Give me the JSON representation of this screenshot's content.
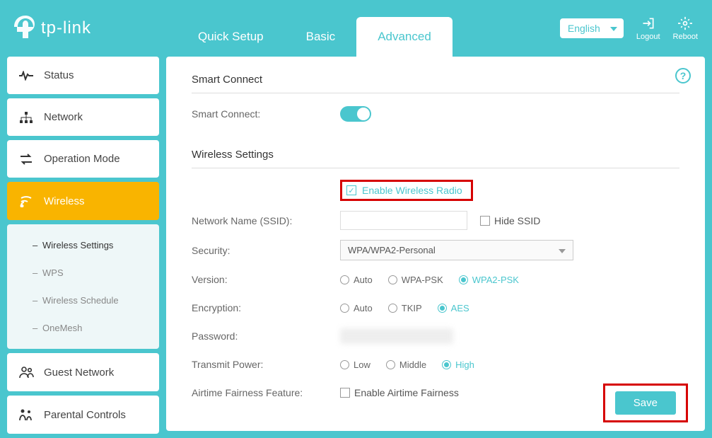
{
  "brand": "tp-link",
  "tabs": {
    "quick": "Quick Setup",
    "basic": "Basic",
    "advanced": "Advanced"
  },
  "lang": "English",
  "hdr": {
    "logout": "Logout",
    "reboot": "Reboot"
  },
  "sidebar": {
    "status": "Status",
    "network": "Network",
    "opmode": "Operation Mode",
    "wireless": "Wireless",
    "guest": "Guest Network",
    "parental": "Parental Controls"
  },
  "submenu": {
    "wset": "Wireless Settings",
    "wps": "WPS",
    "sched": "Wireless Schedule",
    "onemesh": "OneMesh"
  },
  "sections": {
    "smart": "Smart Connect",
    "wireless": "Wireless Settings"
  },
  "labels": {
    "smart_connect": "Smart Connect:",
    "enable_radio": "Enable Wireless Radio",
    "ssid": "Network Name (SSID):",
    "hide_ssid": "Hide SSID",
    "security": "Security:",
    "version": "Version:",
    "encryption": "Encryption:",
    "password": "Password:",
    "tx_power": "Transmit Power:",
    "airtime": "Airtime Fairness Feature:",
    "enable_airtime": "Enable Airtime Fairness"
  },
  "values": {
    "security": "WPA/WPA2-Personal"
  },
  "radios": {
    "version": {
      "auto": "Auto",
      "wpa": "WPA-PSK",
      "wpa2": "WPA2-PSK"
    },
    "encryption": {
      "auto": "Auto",
      "tkip": "TKIP",
      "aes": "AES"
    },
    "power": {
      "low": "Low",
      "mid": "Middle",
      "high": "High"
    }
  },
  "save": "Save"
}
